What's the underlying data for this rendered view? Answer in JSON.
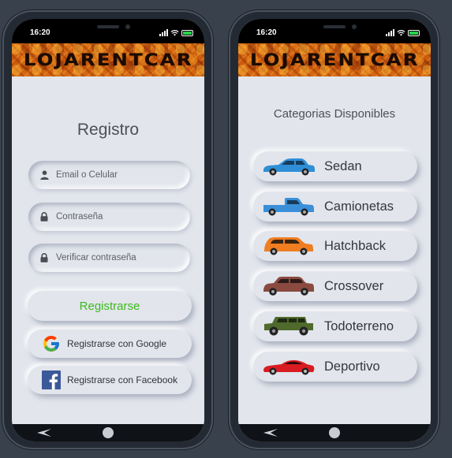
{
  "status_bar": {
    "time": "16:20"
  },
  "brand": {
    "logo_text": "LOJARENTCAR"
  },
  "register_screen": {
    "title": "Registro",
    "email_placeholder": "Email o Celular",
    "password_placeholder": "Contraseña",
    "confirm_password_placeholder": "Verificar contraseña",
    "register_button": "Registrarse",
    "google_button": "Registrarse con Google",
    "facebook_button": "Registrarse con Facebook"
  },
  "categories_screen": {
    "title": "Categorias Disponibles",
    "items": [
      {
        "label": "Sedan",
        "icon": "sedan-car-icon",
        "color": "#2f8fd6"
      },
      {
        "label": "Camionetas",
        "icon": "pickup-truck-icon",
        "color": "#3a8fd8"
      },
      {
        "label": "Hatchback",
        "icon": "hatchback-car-icon",
        "color": "#ef7d22"
      },
      {
        "label": "Crossover",
        "icon": "crossover-car-icon",
        "color": "#8a4a40"
      },
      {
        "label": "Todoterreno",
        "icon": "offroad-car-icon",
        "color": "#4f6a2c"
      },
      {
        "label": "Deportivo",
        "icon": "sports-car-icon",
        "color": "#d81c22"
      }
    ]
  },
  "colors": {
    "accent_green": "#3dba1e",
    "brand_orange": "#d86a14",
    "background": "#e2e5ec"
  }
}
